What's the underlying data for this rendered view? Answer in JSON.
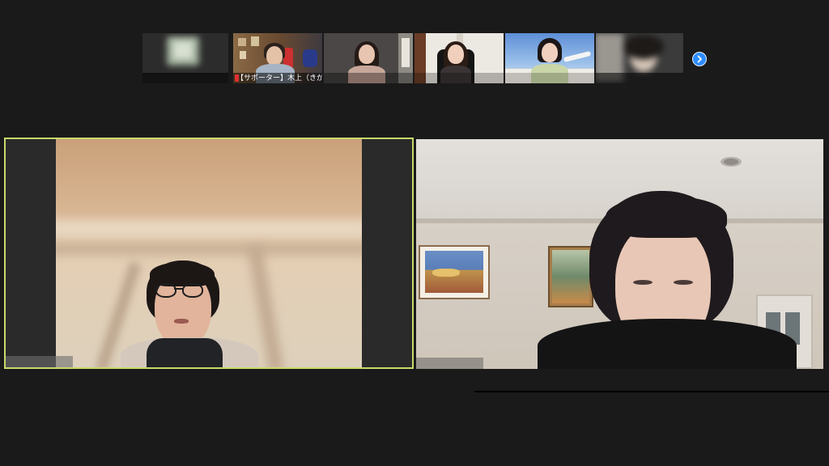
{
  "window": {
    "layout": "gallery-view"
  },
  "participants_strip": {
    "next_icon": "chevron-right-icon",
    "thumbnails": [
      {
        "id": "t1",
        "label": "",
        "blurred": true
      },
      {
        "id": "t2",
        "label": "【サポーター】木上（きがみ…",
        "blurred": false
      },
      {
        "id": "t3",
        "label": "",
        "blurred": false
      },
      {
        "id": "t4",
        "label": "",
        "blurred": false
      },
      {
        "id": "t5",
        "label": "",
        "blurred": false
      },
      {
        "id": "t6",
        "label": "",
        "blurred": true
      }
    ]
  },
  "main_videos": {
    "left": {
      "name": "",
      "active_speaker": true
    },
    "right": {
      "name": "",
      "active_speaker": false
    }
  },
  "colors": {
    "background": "#1a1a1a",
    "active_speaker_border": "#c8d96a",
    "accent": "#2d8cff"
  }
}
